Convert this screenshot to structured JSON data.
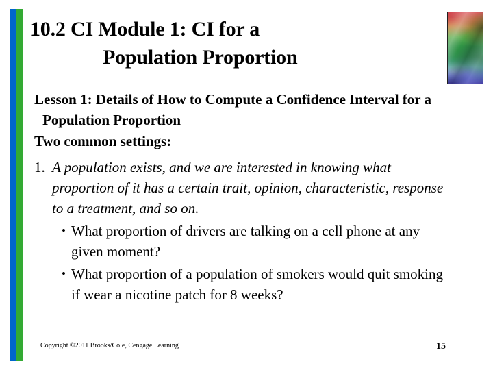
{
  "slide": {
    "title": {
      "line1": "10.2 CI Module 1: CI for a",
      "line2": "Population Proportion"
    },
    "body": {
      "heading_1": "Lesson 1: Details of How to Compute a Confidence Interval for a Population Proportion",
      "heading_2": "Two common settings:",
      "numbered": [
        {
          "marker": "1.",
          "text": "A population exists, and we are interested in knowing what proportion of it has a certain trait, opinion, characteristic, response to a treatment, and so on."
        }
      ],
      "bullets": [
        {
          "marker": "•",
          "text": "What proportion of drivers are talking on a cell phone at any given moment?"
        },
        {
          "marker": "•",
          "text": "What proportion of a population of smokers would quit smoking if wear a nicotine patch for 8 weeks?"
        }
      ]
    },
    "footer": {
      "copyright": "Copyright ©2011 Brooks/Cole, Cengage Learning",
      "page_number": "15"
    },
    "decor": {
      "accent_bar_blue": "#0066cc",
      "accent_bar_green": "#33aa33",
      "artwork_border": "#202020"
    }
  }
}
